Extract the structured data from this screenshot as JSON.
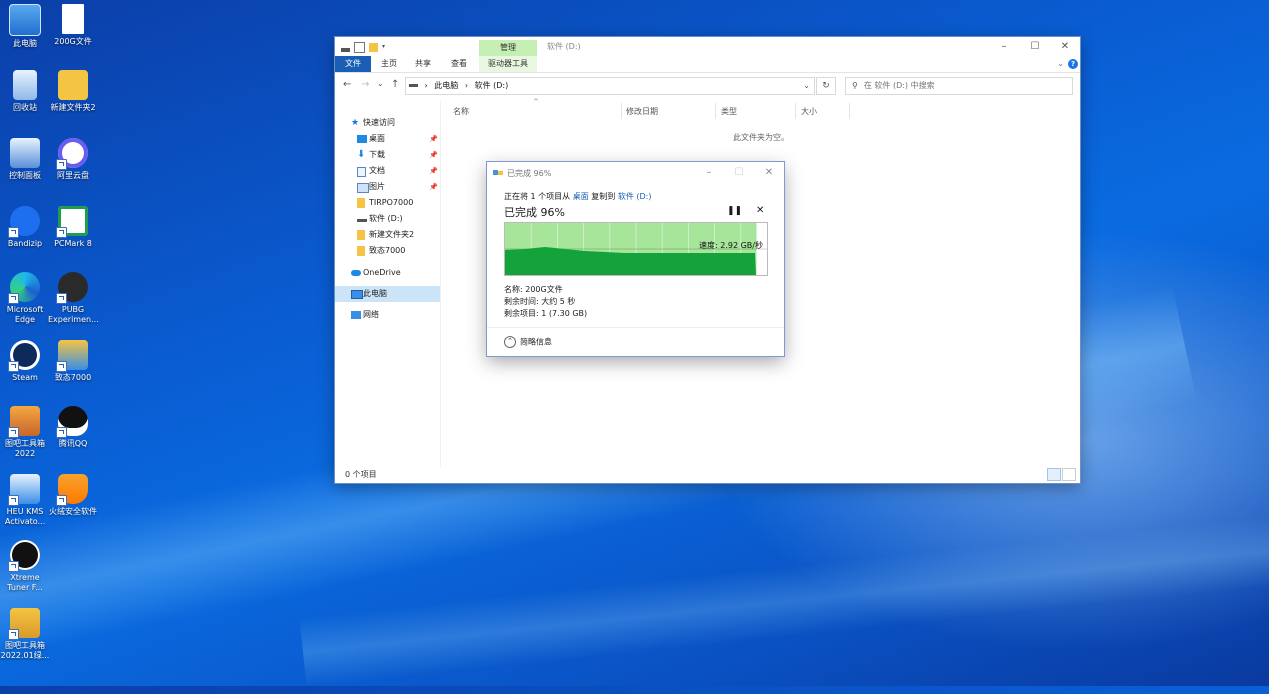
{
  "desktop": {
    "icons": [
      {
        "label": "此电脑"
      },
      {
        "label": "200G文件"
      },
      {
        "label": "回收站"
      },
      {
        "label": "新建文件夹2"
      },
      {
        "label": "控制面板"
      },
      {
        "label": "阿里云盘"
      },
      {
        "label": "Bandizip"
      },
      {
        "label": "PCMark 8"
      },
      {
        "label": "Microsoft Edge"
      },
      {
        "label": "PUBG Experimen..."
      },
      {
        "label": "Steam"
      },
      {
        "label": "致态7000"
      },
      {
        "label": "图吧工具箱 2022"
      },
      {
        "label": "腾讯QQ"
      },
      {
        "label": "HEU KMS Activato..."
      },
      {
        "label": "火绒安全软件"
      },
      {
        "label": "Xtreme Tuner F..."
      },
      {
        "label": "图吧工具箱 2022.01绿..."
      }
    ]
  },
  "explorer": {
    "title": "软件 (D:)",
    "context_tab": "管理",
    "ribbon_tabs": [
      "文件",
      "主页",
      "共享",
      "查看",
      "驱动器工具"
    ],
    "address": {
      "segments": [
        "此电脑",
        "软件 (D:)"
      ]
    },
    "search_placeholder": "在 软件 (D:) 中搜索",
    "nav": {
      "quick_access": "快速访问",
      "items": [
        "桌面",
        "下载",
        "文档",
        "图片",
        "TIRPO7000",
        "软件 (D:)",
        "新建文件夹2",
        "致态7000"
      ],
      "onedrive": "OneDrive",
      "this_pc": "此电脑",
      "network": "网络"
    },
    "columns": [
      "名称",
      "修改日期",
      "类型",
      "大小"
    ],
    "empty_message": "此文件夹为空。",
    "status": "0 个项目"
  },
  "copy_dialog": {
    "title": "已完成 96%",
    "line1_prefix": "正在将 1 个项目从",
    "source": "桌面",
    "line1_mid": "复制到",
    "dest": "软件 (D:)",
    "heading": "已完成 96%",
    "speed": "速度: 2.92 GB/秒",
    "progress": 0.96,
    "name_line": "名称: 200G文件",
    "time_line": "剩余时间: 大约 5 秒",
    "items_line": "剩余项目: 1 (7.30 GB)",
    "brief": "简略信息"
  }
}
